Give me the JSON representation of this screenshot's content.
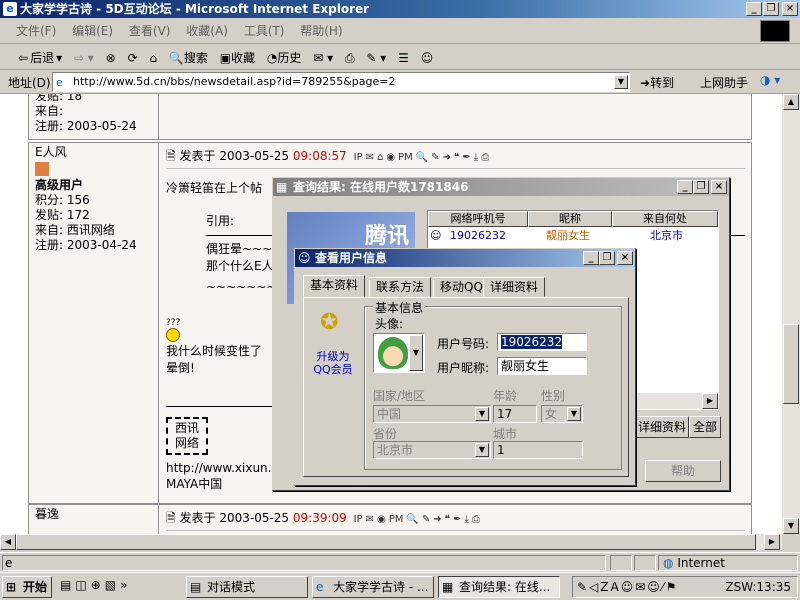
{
  "window": {
    "title": "大家学学古诗 - 5D互动论坛 - Microsoft Internet Explorer"
  },
  "menu": [
    "文件(F)",
    "编辑(E)",
    "查看(V)",
    "收藏(A)",
    "工具(T)",
    "帮助(H)"
  ],
  "toolbar": {
    "back": "后退",
    "search": "搜索",
    "favorites": "收藏",
    "history": "历史"
  },
  "address": {
    "label": "地址(D)",
    "url": "http://www.5d.cn/bbs/newsdetail.asp?id=789255&page=2",
    "go": "转到",
    "helper": "上网助手"
  },
  "posts": {
    "prev": {
      "posts_line": "发贴: 18",
      "from_line": "来自:",
      "reg": "注册: 2003-05-24"
    },
    "p1": {
      "user": "E人风",
      "rank": "高级用户",
      "points": "积分: 156",
      "posts": "发贴: 172",
      "from": "来自: 西讯网络",
      "reg": "注册: 2003-04-24",
      "posted_label": "发表于",
      "date": "2003-05-25",
      "time": "09:08:57",
      "body1": "冷箫轻笛在上个帖",
      "quote_label": "引用:",
      "quote1": "偶狂晕~~~",
      "quote2": "那个什么E人",
      "quote3": "~~~~~~~~",
      "smiley": "???",
      "body2": "我什么时候变性了",
      "body3": "晕倒!",
      "sig1": "西讯",
      "sig2": "网络",
      "sig_url": "http://www.xixun.n",
      "sig_name": "MAYA中国"
    },
    "p2": {
      "user": "暮逸",
      "posted_label": "发表于",
      "date": "2003-05-25",
      "time": "09:39:09"
    }
  },
  "query_window": {
    "title": "查询结果: 在线用户数1781846",
    "columns": [
      "网络呼机号",
      "昵称",
      "来自何处"
    ],
    "row": {
      "id": "19026232",
      "nick": "靓丽女生",
      "from": "北京市"
    },
    "banner": "腾讯",
    "btn_detail": "详细资料",
    "btn_all": "全部",
    "btn_help": "帮助"
  },
  "user_window": {
    "title": "查看用户信息",
    "tabs": [
      "基本资料",
      "联系方法",
      "移动QQ",
      "详细资料"
    ],
    "upgrade": "升级为QQ会员",
    "group": "基本信息",
    "avatar_label": "头像:",
    "uid_label": "用户号码:",
    "uid": "19026232",
    "nick_label": "用户昵称:",
    "nick": "靓丽女生",
    "country_label": "国家/地区",
    "country": "中国",
    "age_label": "年龄",
    "age": "17",
    "gender_label": "性别",
    "gender": "女",
    "province_label": "省份",
    "province": "北京市",
    "city_label": "城市",
    "city": "1"
  },
  "status": {
    "zone": "Internet"
  },
  "taskbar": {
    "start": "开始",
    "tasks": [
      "对话模式",
      "大家学学古诗 - ...",
      "查询结果: 在线..."
    ],
    "clock": "ZSW:13:35"
  }
}
